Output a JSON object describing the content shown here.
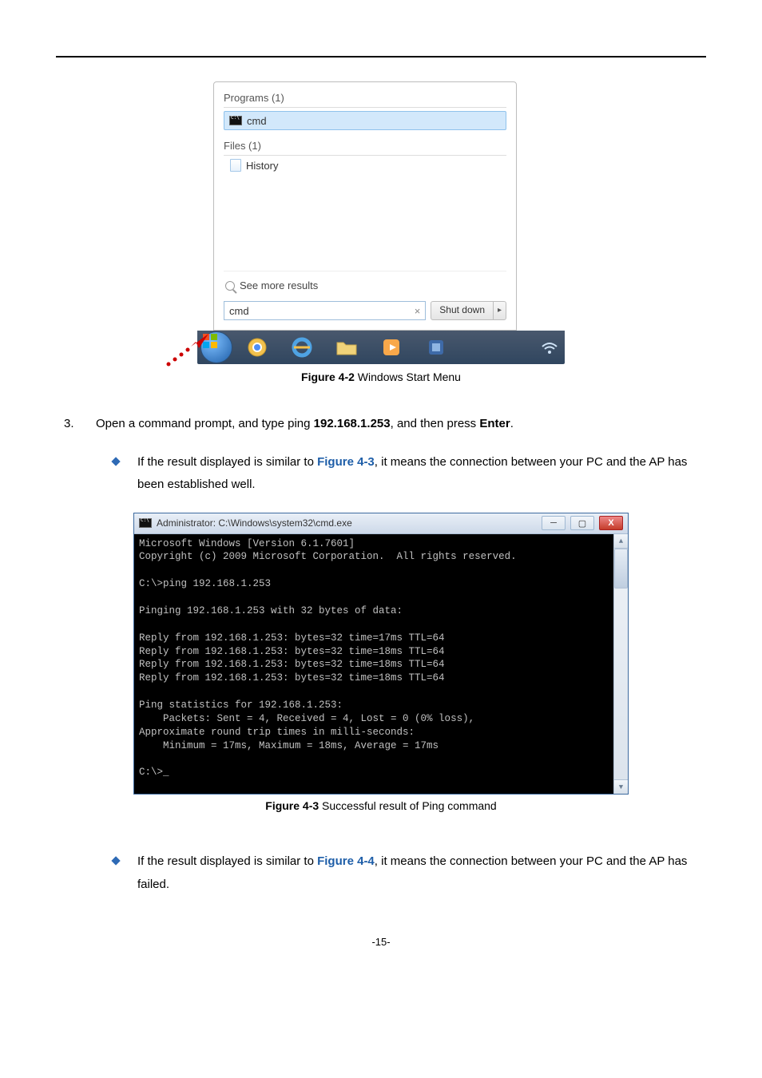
{
  "figure42": {
    "programs_label": "Programs (1)",
    "cmd_item": "cmd",
    "files_label": "Files (1)",
    "history_item": "History",
    "see_more": "See more results",
    "search_value": "cmd",
    "shutdown_label": "Shut down",
    "caption_bold": "Figure 4-2",
    "caption_rest": " Windows Start Menu"
  },
  "step3": {
    "number": "3.",
    "text_before": "Open a command prompt, and type ping ",
    "ip": "192.168.1.253",
    "text_mid": ", and then press ",
    "enter": "Enter",
    "text_after": "."
  },
  "bullet1": {
    "pre": "If the result displayed is similar to ",
    "ref": "Figure 4-3",
    "post": ", it means the connection between your PC and the AP has been established well."
  },
  "cmd43": {
    "title": "Administrator: C:\\Windows\\system32\\cmd.exe",
    "body": "Microsoft Windows [Version 6.1.7601]\nCopyright (c) 2009 Microsoft Corporation.  All rights reserved.\n\nC:\\>ping 192.168.1.253\n\nPinging 192.168.1.253 with 32 bytes of data:\n\nReply from 192.168.1.253: bytes=32 time=17ms TTL=64\nReply from 192.168.1.253: bytes=32 time=18ms TTL=64\nReply from 192.168.1.253: bytes=32 time=18ms TTL=64\nReply from 192.168.1.253: bytes=32 time=18ms TTL=64\n\nPing statistics for 192.168.1.253:\n    Packets: Sent = 4, Received = 4, Lost = 0 (0% loss),\nApproximate round trip times in milli-seconds:\n    Minimum = 17ms, Maximum = 18ms, Average = 17ms\n\nC:\\>_",
    "caption_bold": "Figure 4-3",
    "caption_rest": " Successful result of Ping command"
  },
  "bullet2": {
    "pre": "If the result displayed is similar to ",
    "ref": "Figure 4-4",
    "post": ", it means the connection between your PC and the AP has failed."
  },
  "page_number": "-15-"
}
